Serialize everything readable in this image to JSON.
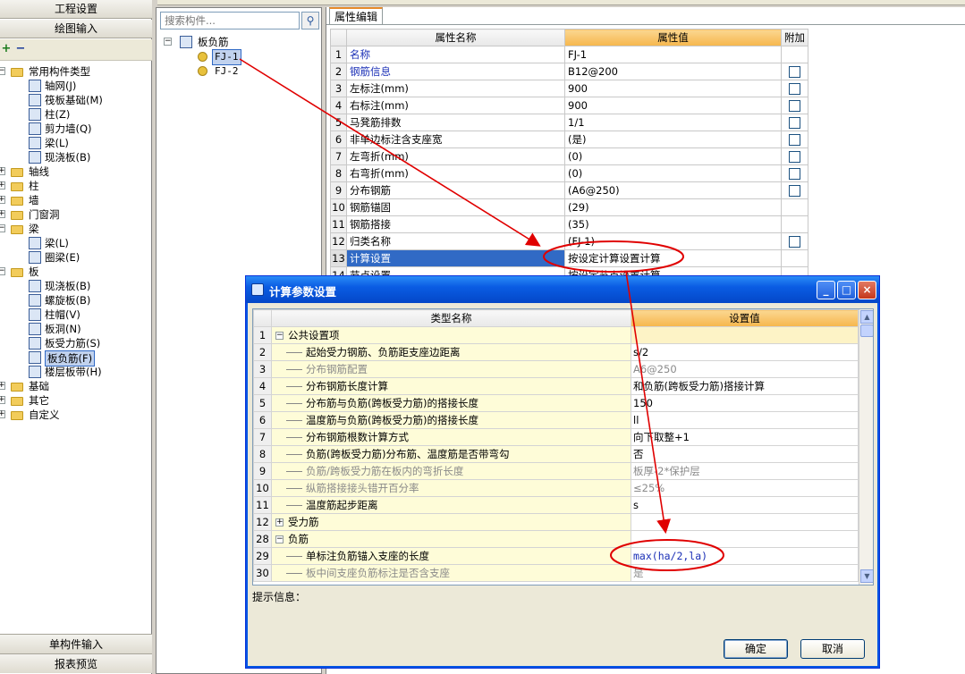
{
  "nav": {
    "header_top": "工程设置",
    "header_draw": "绘图输入",
    "toolbar": {
      "add": "+",
      "remove": "−"
    },
    "tree": [
      {
        "label": "常用构件类型",
        "level": 0,
        "folder": true,
        "expanded": true
      },
      {
        "label": "轴网(J)",
        "level": 1
      },
      {
        "label": "筏板基础(M)",
        "level": 1
      },
      {
        "label": "柱(Z)",
        "level": 1
      },
      {
        "label": "剪力墙(Q)",
        "level": 1
      },
      {
        "label": "梁(L)",
        "level": 1
      },
      {
        "label": "现浇板(B)",
        "level": 1
      },
      {
        "label": "轴线",
        "level": 0,
        "folder": true,
        "expanded": false
      },
      {
        "label": "柱",
        "level": 0,
        "folder": true,
        "expanded": false
      },
      {
        "label": "墙",
        "level": 0,
        "folder": true,
        "expanded": false
      },
      {
        "label": "门窗洞",
        "level": 0,
        "folder": true,
        "expanded": false
      },
      {
        "label": "梁",
        "level": 0,
        "folder": true,
        "expanded": true
      },
      {
        "label": "梁(L)",
        "level": 1
      },
      {
        "label": "圈梁(E)",
        "level": 1
      },
      {
        "label": "板",
        "level": 0,
        "folder": true,
        "expanded": true
      },
      {
        "label": "现浇板(B)",
        "level": 1
      },
      {
        "label": "螺旋板(B)",
        "level": 1
      },
      {
        "label": "柱帽(V)",
        "level": 1
      },
      {
        "label": "板洞(N)",
        "level": 1
      },
      {
        "label": "板受力筋(S)",
        "level": 1
      },
      {
        "label": "板负筋(F)",
        "level": 1,
        "selected": true
      },
      {
        "label": "楼层板带(H)",
        "level": 1
      },
      {
        "label": "基础",
        "level": 0,
        "folder": true,
        "expanded": false
      },
      {
        "label": "其它",
        "level": 0,
        "folder": true,
        "expanded": false
      },
      {
        "label": "自定义",
        "level": 0,
        "folder": true,
        "expanded": false
      }
    ],
    "footer_single": "单构件输入",
    "footer_report": "报表预览"
  },
  "components": {
    "search_placeholder": "搜索构件...",
    "root": "板负筋",
    "items": [
      "FJ-1",
      "FJ-2"
    ],
    "selected": "FJ-1"
  },
  "properties": {
    "tab": "属性编辑",
    "headers": {
      "name": "属性名称",
      "value": "属性值",
      "extra": "附加"
    },
    "rows": [
      {
        "no": "1",
        "name": "名称",
        "value": "FJ-1",
        "blue": true,
        "check": false
      },
      {
        "no": "2",
        "name": "钢筋信息",
        "value": "B12@200",
        "blue": true,
        "check": true
      },
      {
        "no": "3",
        "name": "左标注(mm)",
        "value": "900",
        "check": true
      },
      {
        "no": "4",
        "name": "右标注(mm)",
        "value": "900",
        "check": true
      },
      {
        "no": "5",
        "name": "马凳筋排数",
        "value": "1/1",
        "check": true
      },
      {
        "no": "6",
        "name": "非单边标注含支座宽",
        "value": "(是)",
        "check": true
      },
      {
        "no": "7",
        "name": "左弯折(mm)",
        "value": "(0)",
        "check": true
      },
      {
        "no": "8",
        "name": "右弯折(mm)",
        "value": "(0)",
        "check": true
      },
      {
        "no": "9",
        "name": "分布钢筋",
        "value": "(A6@250)",
        "check": true
      },
      {
        "no": "10",
        "name": "钢筋锚固",
        "value": "(29)",
        "check": false
      },
      {
        "no": "11",
        "name": "钢筋搭接",
        "value": "(35)",
        "check": false
      },
      {
        "no": "12",
        "name": "归类名称",
        "value": "(FJ-1)",
        "check": true
      },
      {
        "no": "13",
        "name": "计算设置",
        "value": "按设定计算设置计算",
        "selected": true,
        "check": false
      },
      {
        "no": "14",
        "name": "节点设置",
        "value": "按设定节点设置计算",
        "check": false
      }
    ]
  },
  "dialog": {
    "title": "计算参数设置",
    "headers": {
      "name": "类型名称",
      "value": "设置值"
    },
    "rows": [
      {
        "no": "1",
        "name": "公共设置项",
        "value": "",
        "group": true,
        "expanded": true
      },
      {
        "no": "2",
        "name": "起始受力钢筋、负筋距支座边距离",
        "value": "s/2"
      },
      {
        "no": "3",
        "name": "分布钢筋配置",
        "value": "A6@250",
        "grey": true
      },
      {
        "no": "4",
        "name": "分布钢筋长度计算",
        "value": "和负筋(跨板受力筋)搭接计算"
      },
      {
        "no": "5",
        "name": "分布筋与负筋(跨板受力筋)的搭接长度",
        "value": "150"
      },
      {
        "no": "6",
        "name": "温度筋与负筋(跨板受力筋)的搭接长度",
        "value": "ll"
      },
      {
        "no": "7",
        "name": "分布钢筋根数计算方式",
        "value": "向下取整+1"
      },
      {
        "no": "8",
        "name": "负筋(跨板受力筋)分布筋、温度筋是否带弯勾",
        "value": "否"
      },
      {
        "no": "9",
        "name": "负筋/跨板受力筋在板内的弯折长度",
        "value": "板厚-2*保护层",
        "grey": true
      },
      {
        "no": "10",
        "name": "纵筋搭接接头错开百分率",
        "value": "≤25%",
        "grey": true
      },
      {
        "no": "11",
        "name": "温度筋起步距离",
        "value": "s"
      },
      {
        "no": "12",
        "name": "受力筋",
        "value": "",
        "group": true,
        "expanded": false
      },
      {
        "no": "28",
        "name": "负筋",
        "value": "",
        "group": true,
        "expanded": true
      },
      {
        "no": "29",
        "name": "单标注负筋锚入支座的长度",
        "value": "max(ha/2,la)",
        "blue": true
      },
      {
        "no": "30",
        "name": "板中间支座负筋标注是否含支座",
        "value": "是",
        "grey": true
      }
    ],
    "hint_label": "提示信息：",
    "ok": "确定",
    "cancel": "取消",
    "controls": {
      "minimize": "_",
      "maximize": "□",
      "close": "×"
    }
  },
  "colors": {
    "annotation": "#e00000",
    "selection": "#316ac5",
    "header_orange": "#f6b64c"
  }
}
